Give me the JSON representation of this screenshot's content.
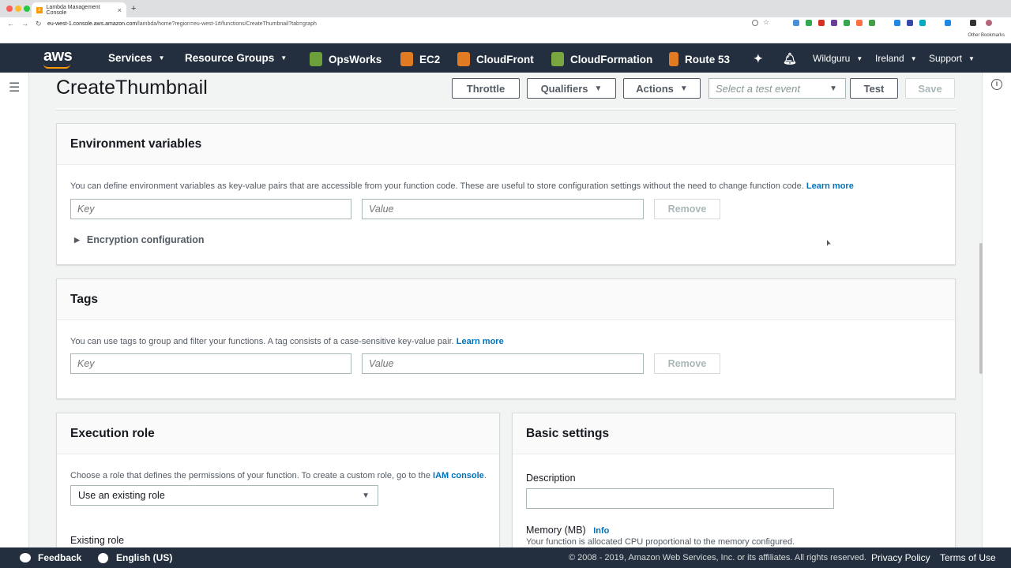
{
  "browser": {
    "tab_title": "Lambda Management Console",
    "tab_close": "×",
    "new_tab": "+",
    "url_host": "eu-west-1.console.aws.amazon.com",
    "url_path": "/lambda/home?region=eu-west-1#/functions/CreateThumbnail?tab=graph",
    "bookmarks_other": "Other Bookmarks"
  },
  "aws_nav": {
    "logo": "aws",
    "services": "Services",
    "resource_groups": "Resource Groups",
    "opsworks": "OpsWorks",
    "ec2": "EC2",
    "cloudfront": "CloudFront",
    "cloudformation": "CloudFormation",
    "route53": "Route 53",
    "account": "Wildguru",
    "region": "Ireland",
    "support": "Support",
    "colors": {
      "bar": "#232f3e",
      "accent": "#ff9900"
    }
  },
  "page": {
    "title": "CreateThumbnail",
    "buttons": {
      "throttle": "Throttle",
      "qualifiers": "Qualifiers",
      "actions": "Actions",
      "test_event_placeholder": "Select a test event",
      "test": "Test",
      "save": "Save"
    }
  },
  "env_vars": {
    "title": "Environment variables",
    "description": "You can define environment variables as key-value pairs that are accessible from your function code. These are useful to store configuration settings without the need to change function code.",
    "learn_more": "Learn more",
    "key_placeholder": "Key",
    "value_placeholder": "Value",
    "remove": "Remove",
    "encryption": "Encryption configuration"
  },
  "tags": {
    "title": "Tags",
    "description": "You can use tags to group and filter your functions. A tag consists of a case-sensitive key-value pair.",
    "learn_more": "Learn more",
    "key_placeholder": "Key",
    "value_placeholder": "Value",
    "remove": "Remove"
  },
  "execution_role": {
    "title": "Execution role",
    "description": "Choose a role that defines the permissions of your function. To create a custom role, go to the",
    "iam_link": "IAM console",
    "period": ".",
    "selected": "Use an existing role",
    "existing_role_label": "Existing role"
  },
  "basic_settings": {
    "title": "Basic settings",
    "description_label": "Description",
    "description_value": "",
    "memory_label": "Memory (MB)",
    "memory_info": "Info",
    "memory_hint": "Your function is allocated CPU proportional to the memory configured."
  },
  "footer": {
    "feedback": "Feedback",
    "language": "English (US)",
    "copyright": "© 2008 - 2019, Amazon Web Services, Inc. or its affiliates. All rights reserved.",
    "privacy": "Privacy Policy",
    "terms": "Terms of Use"
  }
}
